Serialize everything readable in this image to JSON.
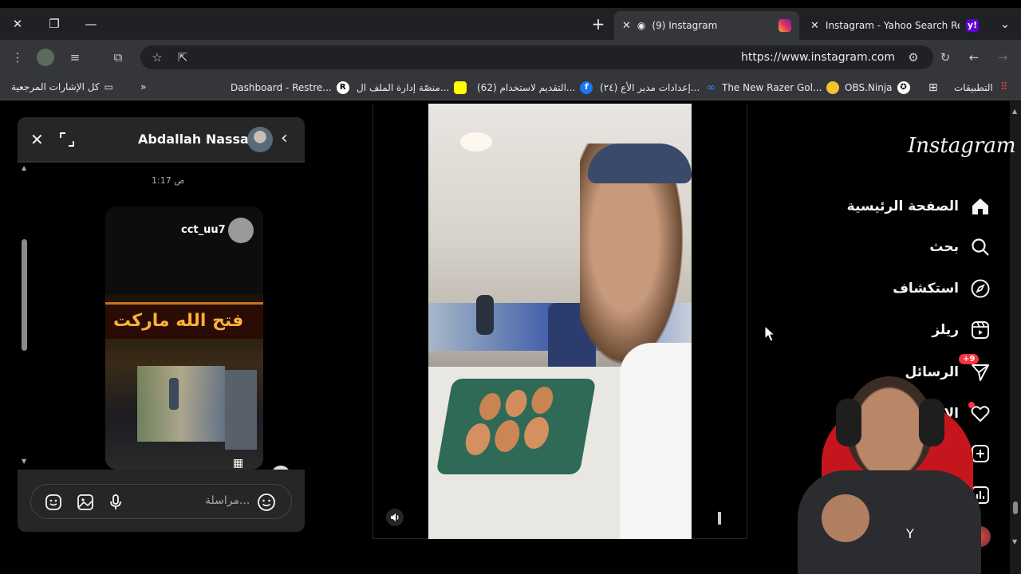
{
  "browser": {
    "tabs": [
      {
        "title": "(9) Instagram",
        "active": true
      },
      {
        "title": "Instagram - Yahoo Search Resul",
        "active": false
      }
    ],
    "url": "https://www.instagram.com"
  },
  "bookmarks": {
    "all_bookmarks": "كل الإشارات المرجعية",
    "items": [
      {
        "label": "Dashboard - Restre...",
        "badge": "R"
      },
      {
        "label": "منصّة إدارة الملف ال...",
        "badge": ""
      },
      {
        "label": "(62) التقديم لاستخدام...",
        "badge": "f"
      },
      {
        "label": "(٢٤) إعدادات مدير الأع...",
        "badge": ""
      },
      {
        "label": "The New Razer Gol...",
        "badge": ""
      },
      {
        "label": "OBS.Ninja",
        "badge": ""
      },
      {
        "label": "التطبيقات",
        "badge": ""
      }
    ]
  },
  "chat": {
    "contact_name": "Abdallah Nassar",
    "timestamp": "1:17 ص",
    "shared_post_user": "cct_uu7",
    "shop_sign": "فتح الله ماركت",
    "input_placeholder": "مراسلة..."
  },
  "nav": {
    "logo": "Instagram",
    "items": [
      {
        "label": "الصفحة الرئيسية",
        "icon": "home-icon"
      },
      {
        "label": "بحث",
        "icon": "search-icon"
      },
      {
        "label": "استكشاف",
        "icon": "compass-icon"
      },
      {
        "label": "ريلز",
        "icon": "reels-icon"
      },
      {
        "label": "الرسائل",
        "icon": "messages-icon",
        "badge": "+9"
      },
      {
        "label": "الإش",
        "icon": "heart-icon"
      }
    ]
  },
  "colors": {
    "accent_red": "#ff3040",
    "instagram_pink": "#e1306c"
  }
}
